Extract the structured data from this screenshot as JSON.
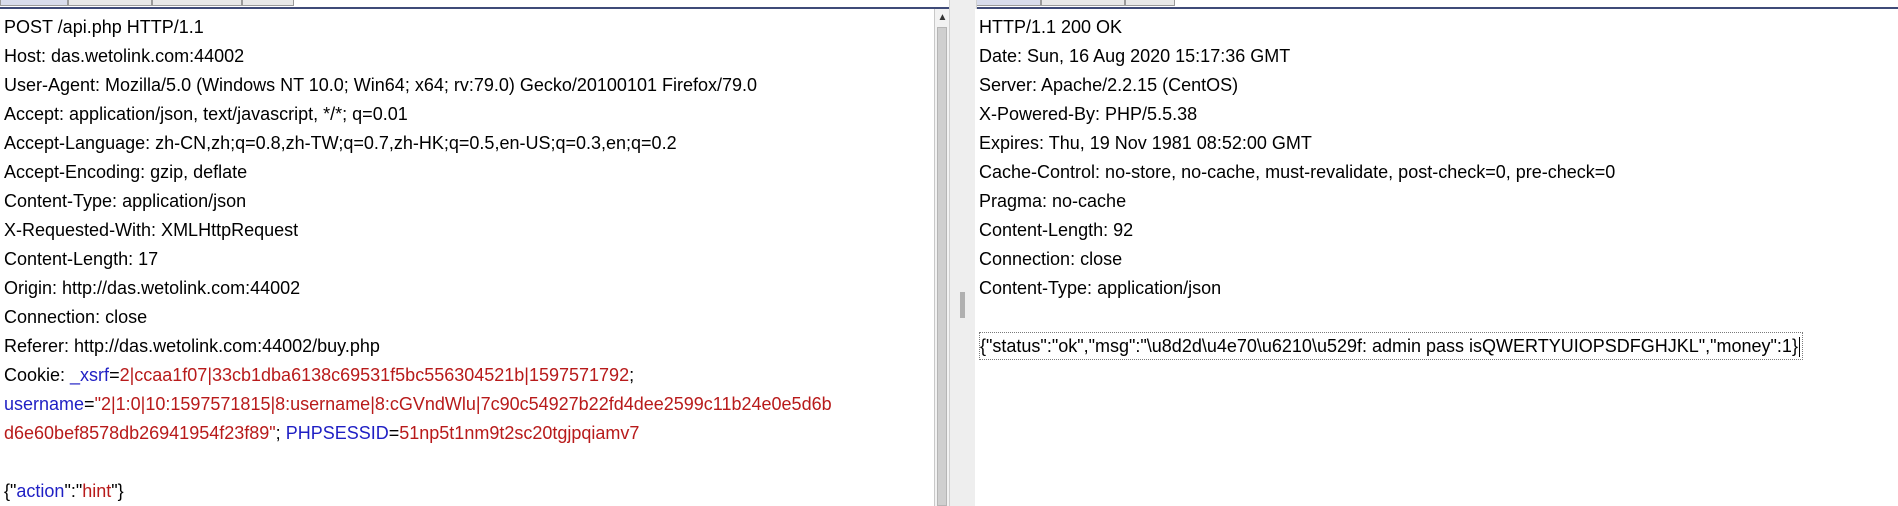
{
  "request": {
    "request_line": "POST /api.php HTTP/1.1",
    "headers": [
      "Host: das.wetolink.com:44002",
      "User-Agent: Mozilla/5.0 (Windows NT 10.0; Win64; x64; rv:79.0) Gecko/20100101 Firefox/79.0",
      "Accept: application/json, text/javascript, */*; q=0.01",
      "Accept-Language: zh-CN,zh;q=0.8,zh-TW;q=0.7,zh-HK;q=0.5,en-US;q=0.3,en;q=0.2",
      "Accept-Encoding: gzip, deflate",
      "Content-Type: application/json",
      "X-Requested-With: XMLHttpRequest",
      "Content-Length: 17",
      "Origin: http://das.wetolink.com:44002",
      "Connection: close",
      "Referer: http://das.wetolink.com:44002/buy.php"
    ],
    "cookie": {
      "label": "Cookie: ",
      "xsrf_name": "_xsrf",
      "xsrf_value": "2|ccaa1f07|33cb1dba6138c69531f5bc556304521b|1597571792",
      "username_name": "username",
      "username_value_1": "\"2|1:0|10:1597571815|8:username|8:cGVndWlu|7c90c54927b22fd4dee2599c11b24e0e5d6b",
      "username_value_2": "d6e60bef8578db26941954f23f89\"",
      "phpsessid_name": "PHPSESSID",
      "phpsessid_value": "51np5t1nm9t2sc20tgjpqiamv7"
    },
    "body": {
      "open": "{\"",
      "key": "action",
      "colon": "\":\"",
      "value": "hint",
      "close": "\"}"
    }
  },
  "response": {
    "status_line": "HTTP/1.1 200 OK",
    "headers": [
      "Date: Sun, 16 Aug 2020 15:17:36 GMT",
      "Server: Apache/2.2.15 (CentOS)",
      "X-Powered-By: PHP/5.5.38",
      "Expires: Thu, 19 Nov 1981 08:52:00 GMT",
      "Cache-Control: no-store, no-cache, must-revalidate, post-check=0, pre-check=0",
      "Pragma: no-cache",
      "Content-Length: 92",
      "Connection: close",
      "Content-Type: application/json"
    ],
    "body": "{\"status\":\"ok\",\"msg\":\"\\u8d2d\\u4e70\\u6210\\u529f: admin pass  isQWERTYUIOPSDFGHJKL\",\"money\":1}"
  }
}
